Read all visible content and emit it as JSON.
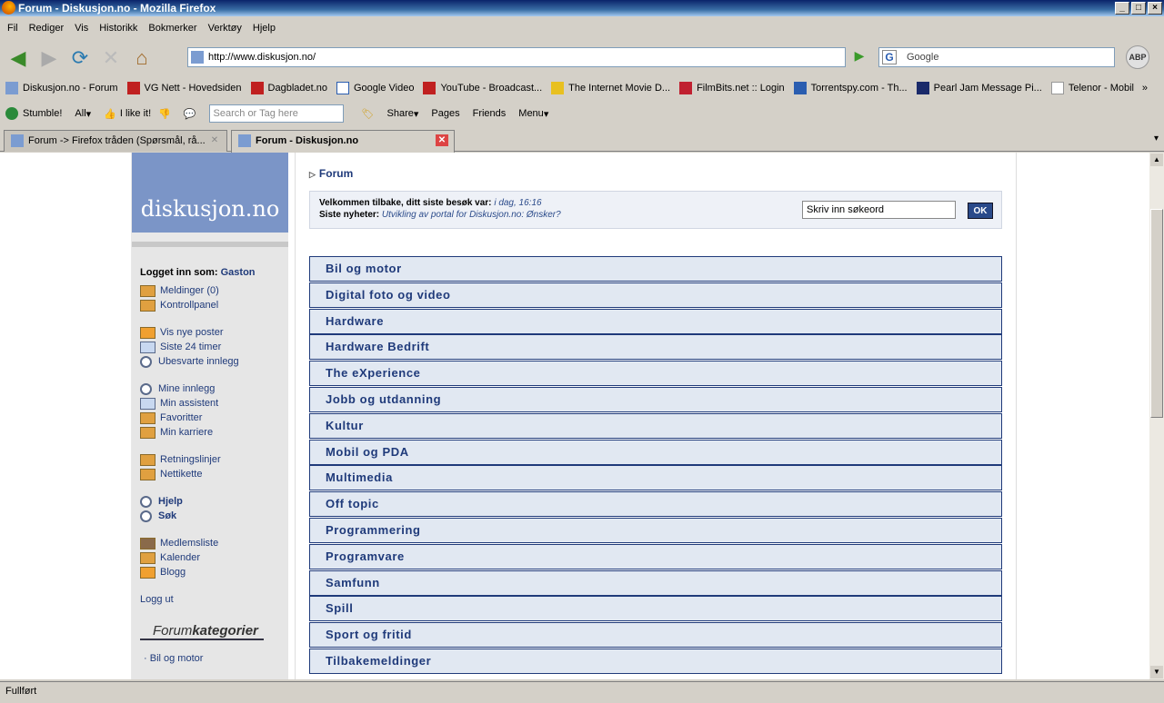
{
  "window": {
    "title": "Forum - Diskusjon.no - Mozilla Firefox"
  },
  "menu": [
    "Fil",
    "Rediger",
    "Vis",
    "Historikk",
    "Bokmerker",
    "Verktøy",
    "Hjelp"
  ],
  "nav": {
    "url": "http://www.diskusjon.no/",
    "search_placeholder": "Google",
    "abp": "ABP"
  },
  "bookmarks": [
    "Diskusjon.no - Forum",
    "VG Nett - Hovedsiden",
    "Dagbladet.no",
    "Google Video",
    "YouTube - Broadcast...",
    "The Internet Movie D...",
    "FilmBits.net :: Login",
    "Torrentspy.com - Th...",
    "Pearl Jam Message Pi...",
    "Telenor - Mobil"
  ],
  "toolbar2": {
    "stumble": "Stumble!",
    "all": "All",
    "like": "I like it!",
    "search_placeholder": "Search or Tag here",
    "share": "Share",
    "pages": "Pages",
    "friends": "Friends",
    "menu": "Menu"
  },
  "tabs": [
    "Forum -> Firefox tråden (Spørsmål, rå...",
    "Forum - Diskusjon.no"
  ],
  "status": "Fullført",
  "logo": "diskusjon.no",
  "sidebar": {
    "logged_in_label": "Logget inn som:",
    "user": "Gaston",
    "links1": [
      "Meldinger (0)",
      "Kontrollpanel"
    ],
    "links2": [
      "Vis nye poster",
      "Siste 24 timer",
      "Ubesvarte innlegg"
    ],
    "links3": [
      "Mine innlegg",
      "Min assistent",
      "Favoritter",
      "Min karriere"
    ],
    "links4": [
      "Retningslinjer",
      "Nettikette"
    ],
    "links5": [
      "Hjelp",
      "Søk"
    ],
    "links6": [
      "Medlemsliste",
      "Kalender",
      "Blogg"
    ],
    "logout": "Logg ut",
    "forumkat_a": "Forum",
    "forumkat_b": "kategorier",
    "first_cat": "Bil og motor"
  },
  "main": {
    "breadcrumb": "Forum",
    "welcome_label": "Velkommen tilbake, ditt siste besøk var:",
    "welcome_value": "i dag, 16:16",
    "news_label": "Siste nyheter:",
    "news_value": "Utvikling av portal for Diskusjon.no: Ønsker?",
    "search_value": "Skriv inn søkeord",
    "ok": "OK",
    "categories": [
      "Bil og motor",
      "Digital foto og video",
      "Hardware",
      "Hardware Bedrift",
      "The eXperience",
      "Jobb og utdanning",
      "Kultur",
      "Mobil og PDA",
      "Multimedia",
      "Off topic",
      "Programmering",
      "Programvare",
      "Samfunn",
      "Spill",
      "Sport og fritid",
      "Tilbakemeldinger"
    ]
  }
}
